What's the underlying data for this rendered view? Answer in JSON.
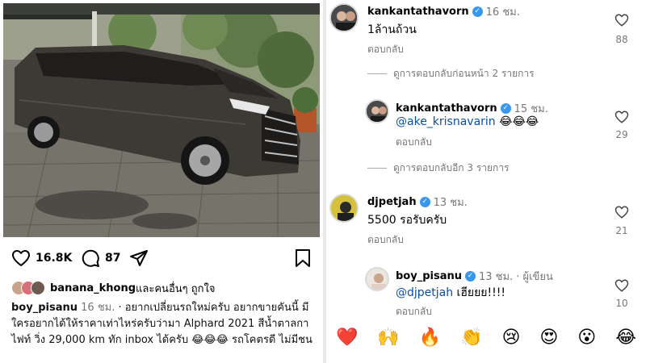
{
  "post": {
    "likes": "16.8K",
    "comments": "87",
    "liked_by_user": "banana_khong",
    "liked_by_suffix": " และคนอื่นๆ ถูกใจ",
    "caption_user": "boy_pisanu",
    "caption_time": "16 ชม.",
    "caption_text": " · อยากเปลี่ยนรถใหม่ครับ อยากขายคันนี้ มีใครอยากได้ให้ราคาเท่าไหร่ครับว่ามา Alphard 2021 สีน้ำตาลกาไฟท์ วิ่ง 29,000 km ทัก inbox ได้ครับ 😂😂😂 รถโคตรดี ไม่มีชน"
  },
  "comments": [
    {
      "user": "kankantathavorn",
      "time": "16 ชม.",
      "text": "1ล้านถ้วน",
      "reply": "ตอบกลับ",
      "likes": "88",
      "more": "ดูการตอบกลับก่อนหน้า 2 รายการ"
    },
    {
      "user": "kankantathavorn",
      "time": "15 ชม.",
      "mention": "@ake_krisnavarin",
      "text": " 😂😂😂",
      "reply": "ตอบกลับ",
      "likes": "29",
      "more": "ดูการตอบกลับอีก 3 รายการ"
    },
    {
      "user": "djpetjah",
      "time": "13 ชม.",
      "text": "5500  รอรับครับ",
      "reply": "ตอบกลับ",
      "likes": "21"
    },
    {
      "user": "boy_pisanu",
      "time": "13 ชม.",
      "author_tag": "· ผู้เขียน",
      "mention": "@djpetjah",
      "text": " เฮียยย!!!!",
      "reply": "ตอบกลับ",
      "likes": "10"
    }
  ],
  "emoji_bar": [
    "❤️",
    "🙌",
    "🔥",
    "👏",
    "😢",
    "😍",
    "😮",
    "😂"
  ]
}
